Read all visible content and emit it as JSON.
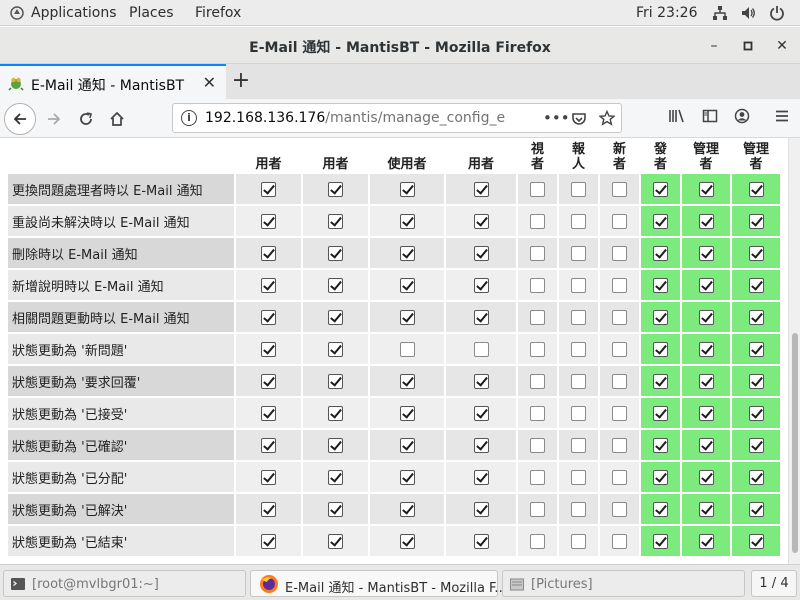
{
  "topbar": {
    "applications": "Applications",
    "places": "Places",
    "firefox": "Firefox",
    "clock": "Fri 23:26",
    "icons": [
      "network-icon",
      "volume-icon",
      "power-icon"
    ]
  },
  "window": {
    "title": "E-Mail 通知 - MantisBT - Mozilla Firefox",
    "minimize": "–",
    "maximize": "▫",
    "close": "✕"
  },
  "browser": {
    "tab_title": "E-Mail 通知 - MantisBT",
    "url_host": "192.168.136.176",
    "url_path": "/mantis/manage_config_email..."
  },
  "table": {
    "headers": [
      {
        "lines": [
          "用者"
        ]
      },
      {
        "lines": [
          "用者"
        ]
      },
      {
        "lines": [
          "使用者"
        ]
      },
      {
        "lines": [
          "用者"
        ]
      },
      {
        "lines": [
          "視",
          "者"
        ]
      },
      {
        "lines": [
          "報",
          "人"
        ]
      },
      {
        "lines": [
          "新",
          "者"
        ]
      },
      {
        "lines": [
          "發",
          "者"
        ]
      },
      {
        "lines": [
          "管理",
          "者"
        ]
      },
      {
        "lines": [
          "管理",
          "者"
        ]
      }
    ],
    "green_columns_from": 7,
    "rows": [
      {
        "label": "更換問題處理者時以 E-Mail 通知",
        "values": [
          1,
          1,
          1,
          1,
          0,
          0,
          0,
          1,
          1,
          1
        ]
      },
      {
        "label": "重設尚未解決時以 E-Mail 通知",
        "values": [
          1,
          1,
          1,
          1,
          0,
          0,
          0,
          1,
          1,
          1
        ]
      },
      {
        "label": "刪除時以 E-Mail 通知",
        "values": [
          1,
          1,
          1,
          1,
          0,
          0,
          0,
          1,
          1,
          1
        ]
      },
      {
        "label": "新增說明時以 E-Mail 通知",
        "values": [
          1,
          1,
          1,
          1,
          0,
          0,
          0,
          1,
          1,
          1
        ]
      },
      {
        "label": "相關問題更動時以 E-Mail 通知",
        "values": [
          1,
          1,
          1,
          1,
          0,
          0,
          0,
          1,
          1,
          1
        ]
      },
      {
        "label": "狀態更動為 '新問題'",
        "values": [
          1,
          1,
          0,
          0,
          0,
          0,
          0,
          1,
          1,
          1
        ]
      },
      {
        "label": "狀態更動為 '要求回覆'",
        "values": [
          1,
          1,
          1,
          1,
          0,
          0,
          0,
          1,
          1,
          1
        ]
      },
      {
        "label": "狀態更動為 '已接受'",
        "values": [
          1,
          1,
          1,
          1,
          0,
          0,
          0,
          1,
          1,
          1
        ]
      },
      {
        "label": "狀態更動為 '已確認'",
        "values": [
          1,
          1,
          1,
          1,
          0,
          0,
          0,
          1,
          1,
          1
        ]
      },
      {
        "label": "狀態更動為 '已分配'",
        "values": [
          1,
          1,
          1,
          1,
          0,
          0,
          0,
          1,
          1,
          1
        ]
      },
      {
        "label": "狀態更動為 '已解決'",
        "values": [
          1,
          1,
          1,
          1,
          0,
          0,
          0,
          1,
          1,
          1
        ]
      },
      {
        "label": "狀態更動為 '已結束'",
        "values": [
          1,
          1,
          1,
          1,
          0,
          0,
          0,
          1,
          1,
          1
        ]
      }
    ]
  },
  "taskbar": {
    "items": [
      {
        "label": "[root@mvlbgr01:~]",
        "icon": "terminal-icon"
      },
      {
        "label": "E-Mail 通知 - MantisBT - Mozilla F...",
        "icon": "firefox-icon"
      },
      {
        "label": "[Pictures]",
        "icon": "folder-icon"
      }
    ],
    "pager": "1 / 4"
  },
  "colors": {
    "green": "#7dea7d",
    "row_dark": "#d8d8d8",
    "row_light": "#e9e9e9",
    "accent": "#0a84ff"
  }
}
